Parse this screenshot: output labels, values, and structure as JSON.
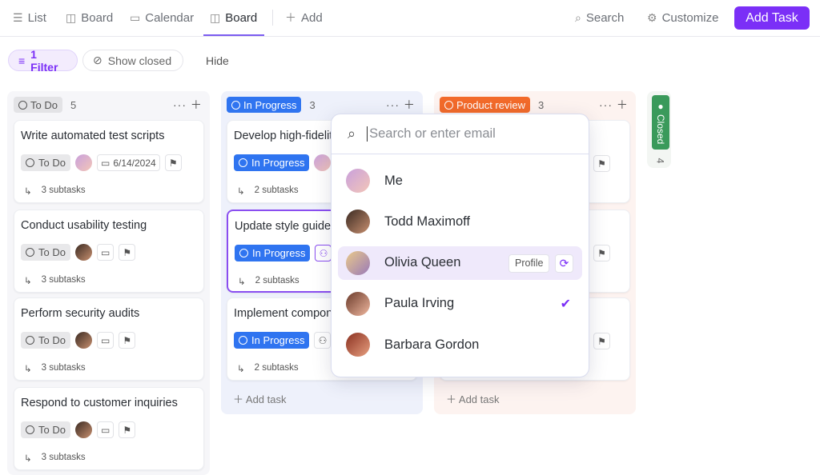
{
  "tabs": [
    {
      "label": "List",
      "icon": "list-icon"
    },
    {
      "label": "Board",
      "icon": "board-icon"
    },
    {
      "label": "Calendar",
      "icon": "calendar-icon"
    },
    {
      "label": "Board",
      "icon": "board-icon",
      "active": true
    },
    {
      "label": "Add",
      "icon": "plus-icon"
    }
  ],
  "toolbar": {
    "search": "Search",
    "customize": "Customize",
    "add_task": "Add Task"
  },
  "filters": {
    "filter": "1 Filter",
    "show_closed": "Show closed",
    "hide": "Hide"
  },
  "colors": {
    "accent": "#7b2ff7",
    "todo": "#e8e8ea",
    "in_progress": "#2f74f0",
    "product_review": "#f26a2a",
    "closed": "#3a9a5b"
  },
  "columns": [
    {
      "name": "To Do",
      "count": "5",
      "add_task": "",
      "cards": [
        {
          "title": "Write automated test scripts",
          "status": "To Do",
          "date": "6/14/2024",
          "subtasks": "3 subtasks"
        },
        {
          "title": "Conduct usability testing",
          "status": "To Do",
          "date": "",
          "subtasks": "3 subtasks"
        },
        {
          "title": "Perform security audits",
          "status": "To Do",
          "date": "",
          "subtasks": "3 subtasks"
        },
        {
          "title": "Respond to customer inquiries",
          "status": "To Do",
          "date": "",
          "subtasks": "3 subtasks"
        }
      ]
    },
    {
      "name": "In Progress",
      "count": "3",
      "add_task": "Add task",
      "cards": [
        {
          "title": "Develop high-fidelity",
          "status": "In Progress",
          "subtasks": "2 subtasks"
        },
        {
          "title": "Update style guide",
          "status": "In Progress",
          "subtasks": "2 subtasks",
          "selected": true
        },
        {
          "title": "Implement components",
          "status": "In Progress",
          "subtasks": "2 subtasks"
        }
      ]
    },
    {
      "name": "Product review",
      "count": "3",
      "add_task": "Add task"
    },
    {
      "name": "Closed",
      "count": "4"
    }
  ],
  "assignee_dropdown": {
    "placeholder": "Search or enter email",
    "people": [
      {
        "name": "Me"
      },
      {
        "name": "Todd Maximoff"
      },
      {
        "name": "Olivia Queen",
        "hovered": true,
        "profile_label": "Profile"
      },
      {
        "name": "Paula Irving",
        "selected": true
      },
      {
        "name": "Barbara Gordon"
      }
    ]
  }
}
